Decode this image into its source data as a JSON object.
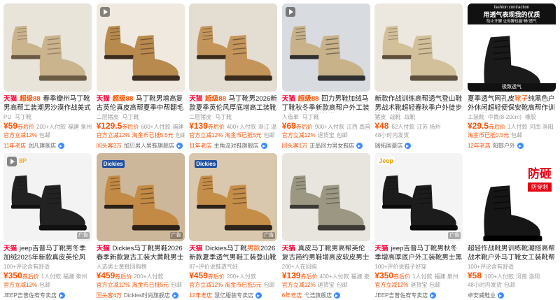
{
  "products": [
    {
      "tag": "天猫 超级88",
      "title": "春季瓣州马丁靴男高帮工装潮男沙漠作战美式伞兵透气",
      "specs": [
        "PU",
        "马丁靴"
      ],
      "price": "¥59",
      "price_label": "券后价",
      "sales": "200+人付款",
      "location": "福建 泉州",
      "promo": [
        "官方立减12%",
        "包邮"
      ],
      "years": "11年老店",
      "shop": "润凡旗舰店",
      "play": false,
      "ad": ""
    },
    {
      "tag": "天猫 超级88",
      "title": "马丁靴男增高复古英伦真皮高帮夏季中帮翻毛皮大黄靴",
      "specs": [
        "二层猪皮",
        "马丁靴"
      ],
      "price": "¥129.5",
      "price_label": "券后价",
      "sales": "600+人付款",
      "location": "福建",
      "promo": [
        "官方立减12%",
        "淘金币已抵5.5元",
        "包邮"
      ],
      "years": "回头客2万",
      "shop": "加贝男人男鞋旗舰店",
      "play": true,
      "ad": ""
    },
    {
      "tag": "天猫 超级88",
      "title": "马丁靴男2026新款夏季英伦风厚底增高工装靴百搭男",
      "specs": [
        "二层猪皮",
        "马丁靴"
      ],
      "price": "¥139",
      "price_label": "券后价",
      "sales": "400+人付款",
      "location": "浙江 温州",
      "promo": [
        "官方立减12%",
        "淘金币已抵5元",
        "包邮"
      ],
      "years": "11年老店",
      "shop": "主角流对鞋旗舰店",
      "play": false,
      "ad": ""
    },
    {
      "tag": "天猫 超级88",
      "title": "回力男鞋加绒马丁靴秋冬季新款高帮户外工装男靴男士雪地棉鞋子",
      "title_highlight": "男靴",
      "specs": [
        "人造革",
        "马丁靴"
      ],
      "price": "¥69",
      "price_label": "券后价",
      "sales": "900+人付款",
      "location": "江西 南昌",
      "promo": [
        "官方立减12%",
        "退货宝",
        "包邮"
      ],
      "years": "回头客1万",
      "shop": "正品回力男女鞋店",
      "play": true,
      "ad": ""
    },
    {
      "tag": "",
      "title": "新款作战训练高帮透气登山鞋男战术靴超轻春秋季户外徒步鞋马丁靴",
      "specs": [
        "猪皮",
        "战靴",
        "战靴"
      ],
      "price": "¥48",
      "price_label": "",
      "sales": "62人付款",
      "location": "江苏 扬州",
      "promo": [
        "48小时内发货"
      ],
      "years": "",
      "shop": "瑞拓国豪店",
      "play": false,
      "ad": ""
    },
    {
      "tag": "",
      "title": "夏季透气网孔皮靴子纯黑色户外休闲超轻便保安靴高帮作训马丁靴",
      "title_highlight": "靴子",
      "specs": [
        "工装靴",
        "中筒(8-20cm)",
        "橡胶"
      ],
      "price": "¥29.5",
      "price_label": "券后价",
      "sales": "1人付款",
      "location": "河南 洛阳",
      "promo": [
        "淘金币已抵0.5元",
        "包邮"
      ],
      "years": "12年老店",
      "shop": "阳邯户外",
      "play": false,
      "ad": "",
      "banner1": "fashion contraction",
      "banner2": "用透气表现我的优质",
      "banner3": "防止汗脚 让你脚也能\"畅\"透气",
      "banner4": "极致透气"
    },
    {
      "tag": "天猫",
      "title": "jeep吉普马丁靴男冬季加绒2025年新款真皮英伦风切尔...",
      "specs": [
        "100+评论含有舒适"
      ],
      "price": "¥350",
      "price_label": "券后价",
      "sales": "1人付款",
      "location": "福建 泉州",
      "promo": [
        "官方立减12%",
        "包邮"
      ],
      "years": "",
      "shop": "JEEP吉普佐宥专卖店",
      "play": true,
      "ad": "广告",
      "badge": "8P"
    },
    {
      "tag": "天猫",
      "title": "Dickies马丁靴男鞋2026春季新款复古工装大黄靴男士户外登",
      "specs": [
        "人选男士黄靴回购榜"
      ],
      "price": "¥459",
      "price_label": "券后价",
      "sales": "200+人付款",
      "location": "",
      "promo": [
        "官方立减12%",
        "淘金币已抵5元",
        "包邮"
      ],
      "years": "回头客4万",
      "shop": "Dickies时尚旗舰店",
      "play": false,
      "ad": "广告",
      "badge": "Dickies"
    },
    {
      "tag": "天猫",
      "title": "Dickies马丁靴男款2026新款夏季透气男鞋工装登山靴子男",
      "title_highlight": "男款",
      "specs": [
        "87+评价说鞋透气好"
      ],
      "price": "¥459",
      "price_label": "券后价",
      "sales": "200+人付款",
      "location": "",
      "promo": [
        "官方立减12%",
        "淘金币已抵5元",
        "包邮"
      ],
      "years": "12年老店",
      "shop": "慧亿服装专卖店",
      "play": false,
      "ad": "广告",
      "badge": "Dickies"
    },
    {
      "tag": "天猫",
      "title": "真皮马丁靴男高帮英伦复古简约男鞋增高皮软皮男士工装靴子",
      "title_highlight": "靴子",
      "specs": [
        "200+人在回购"
      ],
      "price": "¥139",
      "price_label": "券后价",
      "sales": "400+人付款",
      "location": "福建 泉州",
      "promo": [
        "官方立减12%",
        "退货宝",
        "包邮"
      ],
      "years": "6年老店",
      "shop": "弋浩旗舰店",
      "play": false,
      "ad": ""
    },
    {
      "tag": "天猫",
      "title": "jeep吉普马丁靴男秋冬季增高厚底户外工装靴男士黑色高帮",
      "specs": [
        "100+评价说鞋子好穿"
      ],
      "price": "¥350",
      "price_label": "券后价",
      "sales": "1人付款",
      "location": "福建 泉州",
      "promo": [
        "官方立减12%",
        "退货宝",
        "包邮"
      ],
      "years": "",
      "shop": "JEEP吉普佐宥专卖店",
      "play": false,
      "ad": "广告",
      "badge": "Jeep"
    },
    {
      "tag": "",
      "title": "超轻作战靴男训练靴潮搭高帮战术靴户外马丁靴女工装靴帮保安靴",
      "specs": [
        "100+评论含有舒适"
      ],
      "price": "¥58",
      "price_label": "",
      "sales": "100+人付款",
      "location": "河南 洛阳",
      "promo": [
        "48小时内发货",
        "包邮"
      ],
      "years": "",
      "shop": "卓安威鞋业",
      "play": false,
      "ad": "",
      "banner1": "防砸",
      "banner2": "防穿刺"
    }
  ]
}
